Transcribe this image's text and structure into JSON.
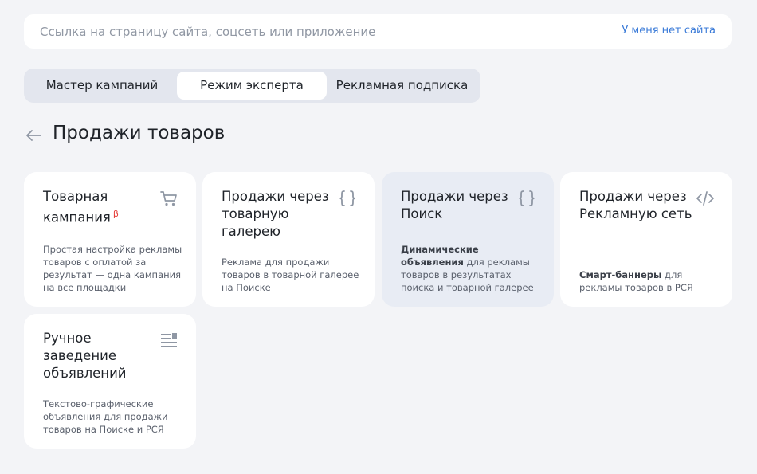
{
  "url_bar": {
    "placeholder": "Ссылка на страницу сайта, соцсеть или приложение",
    "value": "",
    "no_site_label": "У меня нет сайта"
  },
  "mode_tabs": [
    {
      "label": "Мастер кампаний",
      "active": false
    },
    {
      "label": "Режим эксперта",
      "active": true
    },
    {
      "label": "Рекламная подписка",
      "active": false
    }
  ],
  "page_title": "Продажи товаров",
  "cards": [
    {
      "title": "Товарная кампания",
      "badge": "β",
      "icon": "cart-icon",
      "description": "Простая настройка рекламы товаров с оплатой за результат — одна кампания на все площадки"
    },
    {
      "title": "Продажи через товарную галерею",
      "icon": "curly-braces-icon",
      "description": "Реклама для продажи товаров в товарной галерее на Поиске"
    },
    {
      "title": "Продажи через Поиск",
      "icon": "curly-braces-icon",
      "description_bold": "Динамические объявления",
      "description": "для рекламы товаров в результатах поиска и товарной галерее"
    },
    {
      "title": "Продажи через Рекламную сеть",
      "icon": "code-icon",
      "description_bold": "Смарт-баннеры",
      "description": "для рекламы товаров в РСЯ"
    },
    {
      "title": "Ручное заведение объявлений",
      "icon": "text-image-icon",
      "description": "Текстово-графические объявления для продажи товаров на Поиске и РСЯ"
    }
  ],
  "colors": {
    "background": "#f3f4f7",
    "accent_link": "#3b7bd8",
    "beta": "#e53935",
    "icon": "#8f97a4",
    "hovered_card": "#e8ecf4"
  }
}
